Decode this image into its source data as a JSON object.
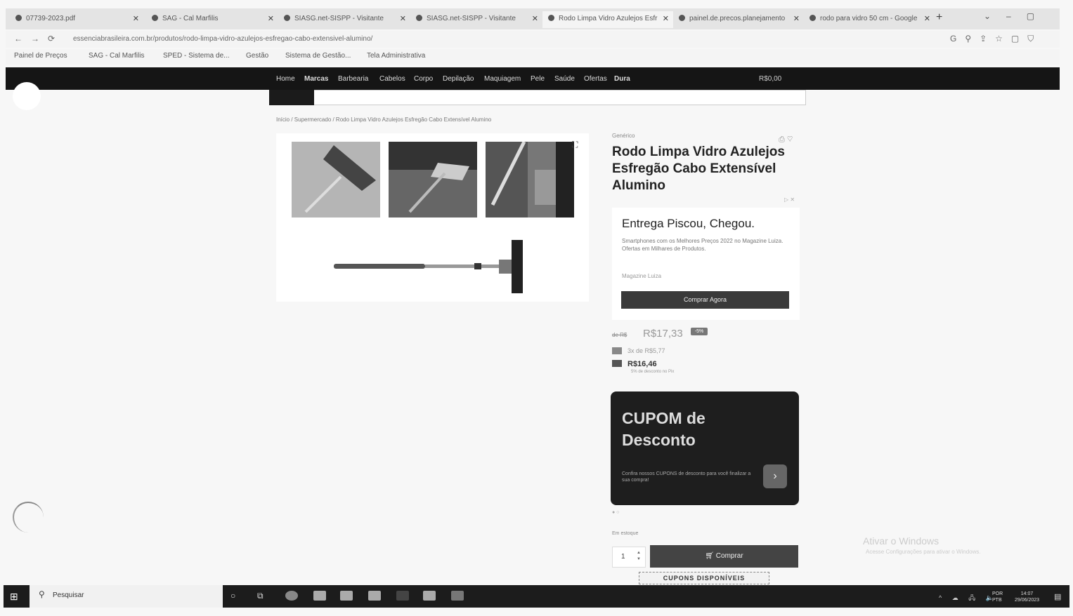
{
  "browser": {
    "tabs": [
      {
        "label": "07739-2023.pdf"
      },
      {
        "label": "SAG - Cal Marfilis"
      },
      {
        "label": "SIASG.net-SISPP - Visitante"
      },
      {
        "label": "SIASG.net-SISPP - Visitante"
      },
      {
        "label": "Rodo Limpa Vidro Azulejos Esfr"
      },
      {
        "label": "painel.de.precos.planejamento"
      },
      {
        "label": "rodo para vidro 50 cm - Google"
      }
    ],
    "url": "essenciabrasileira.com.br/produtos/rodo-limpa-vidro-azulejos-esfregao-cabo-extensivel-alumino/",
    "bookmarks": [
      "Painel de Preços",
      "SAG - Cal Marfilis",
      "SPED - Sistema de...",
      "Gestão",
      "Sistema de Gestão...",
      "Tela Administrativa"
    ]
  },
  "site": {
    "nav": [
      "Home",
      "Marcas",
      "Barbearia",
      "Cabelos",
      "Corpo",
      "Depilação",
      "Maquiagem",
      "Pele",
      "Saúde",
      "Ofertas",
      "Dura"
    ],
    "cart_total": "R$0,00",
    "breadcrumb": "Início  /  Supermercado  /  Rodo Limpa Vidro Azulejos Esfregão Cabo Extensível Alumino",
    "product": {
      "brand": "Genérico",
      "title": "Rodo Limpa Vidro Azulejos Esfregão Cabo Extensível Alumino",
      "old_price_label": "de R$",
      "old_price": "R$17,33",
      "discount": "-5%",
      "installments": "3x de R$5,77",
      "pix_price": "R$16,46",
      "pix_note": "5% de desconto no Pix"
    },
    "promo": {
      "title": "Entrega Piscou, Chegou.",
      "text": "Smartphones com os Melhores Preços 2022 no Magazine Luiza. Ofertas em Milhares de Produtos.",
      "link": "Magazine Luiza",
      "button": "Comprar Agora"
    },
    "coupon": {
      "title": "CUPOM de Desconto",
      "text": "Confira nossos CUPONS de desconto para você finalizar a sua compra!",
      "arrow": "›"
    },
    "stock": "Em estoque",
    "quantity": "1",
    "buy_button": "Comprar",
    "coupons_available": "CUPONS DISPONÍVEIS"
  },
  "windows": {
    "activate_title": "Ativar o Windows",
    "activate_sub": "Acesse Configurações para ativar o Windows.",
    "search_placeholder": "Pesquisar",
    "lang": "POR\nPTB",
    "time": "14:07",
    "date": "29/06/2023"
  }
}
